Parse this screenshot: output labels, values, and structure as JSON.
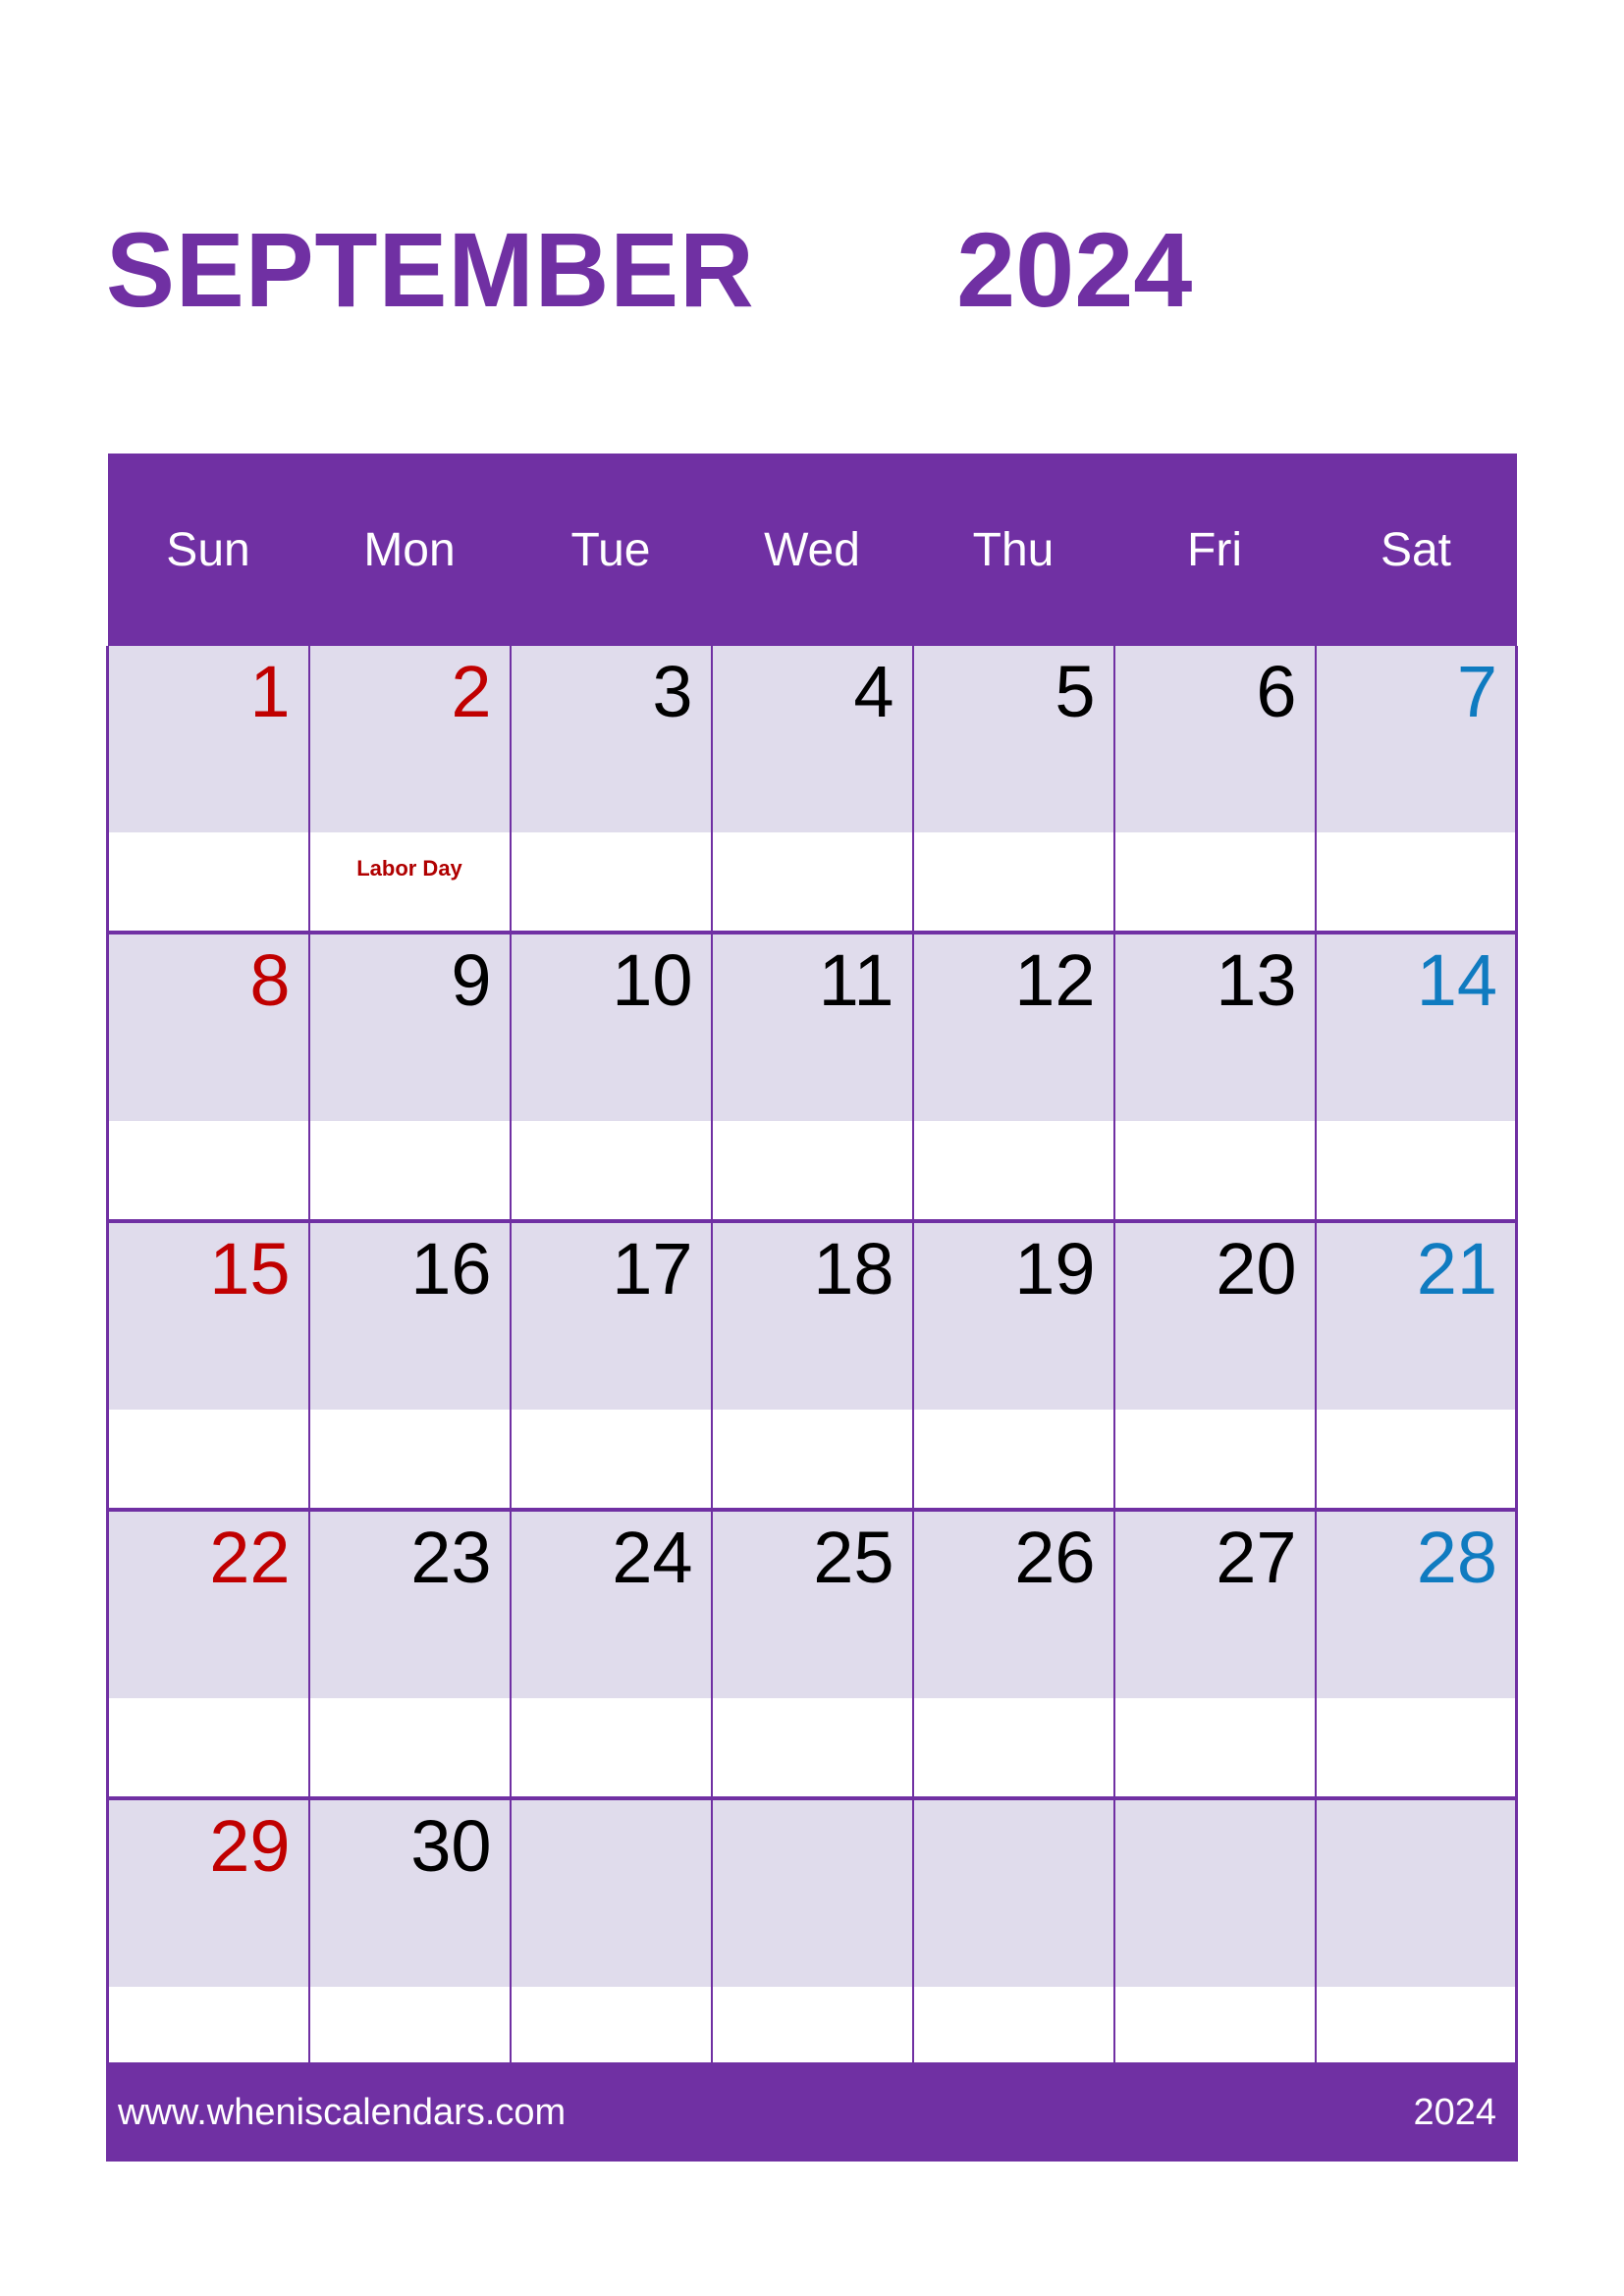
{
  "header": {
    "month": "SEPTEMBER",
    "year": "2024"
  },
  "colors": {
    "purple": "#7030A3",
    "lavender": "#E0DCEC",
    "sunday_red": "#C00000",
    "saturday_blue": "#0F7BC0",
    "event_red": "#B00000",
    "white": "#FFFFFF"
  },
  "weekdays": [
    {
      "label": "Sun"
    },
    {
      "label": "Mon"
    },
    {
      "label": "Tue"
    },
    {
      "label": "Wed"
    },
    {
      "label": "Thu"
    },
    {
      "label": "Fri"
    },
    {
      "label": "Sat"
    }
  ],
  "weeks": [
    {
      "days": [
        {
          "num": "1",
          "kind": "sun",
          "event": ""
        },
        {
          "num": "2",
          "kind": "holiday",
          "event": "Labor Day"
        },
        {
          "num": "3",
          "kind": "weekday",
          "event": ""
        },
        {
          "num": "4",
          "kind": "weekday",
          "event": ""
        },
        {
          "num": "5",
          "kind": "weekday",
          "event": ""
        },
        {
          "num": "6",
          "kind": "weekday",
          "event": ""
        },
        {
          "num": "7",
          "kind": "sat",
          "event": ""
        }
      ]
    },
    {
      "days": [
        {
          "num": "8",
          "kind": "sun",
          "event": ""
        },
        {
          "num": "9",
          "kind": "weekday",
          "event": ""
        },
        {
          "num": "10",
          "kind": "weekday",
          "event": ""
        },
        {
          "num": "11",
          "kind": "weekday",
          "event": ""
        },
        {
          "num": "12",
          "kind": "weekday",
          "event": ""
        },
        {
          "num": "13",
          "kind": "weekday",
          "event": ""
        },
        {
          "num": "14",
          "kind": "sat",
          "event": ""
        }
      ]
    },
    {
      "days": [
        {
          "num": "15",
          "kind": "sun",
          "event": ""
        },
        {
          "num": "16",
          "kind": "weekday",
          "event": ""
        },
        {
          "num": "17",
          "kind": "weekday",
          "event": ""
        },
        {
          "num": "18",
          "kind": "weekday",
          "event": ""
        },
        {
          "num": "19",
          "kind": "weekday",
          "event": ""
        },
        {
          "num": "20",
          "kind": "weekday",
          "event": ""
        },
        {
          "num": "21",
          "kind": "sat",
          "event": ""
        }
      ]
    },
    {
      "days": [
        {
          "num": "22",
          "kind": "sun",
          "event": ""
        },
        {
          "num": "23",
          "kind": "weekday",
          "event": ""
        },
        {
          "num": "24",
          "kind": "weekday",
          "event": ""
        },
        {
          "num": "25",
          "kind": "weekday",
          "event": ""
        },
        {
          "num": "26",
          "kind": "weekday",
          "event": ""
        },
        {
          "num": "27",
          "kind": "weekday",
          "event": ""
        },
        {
          "num": "28",
          "kind": "sat",
          "event": ""
        }
      ]
    },
    {
      "days": [
        {
          "num": "29",
          "kind": "sun",
          "event": ""
        },
        {
          "num": "30",
          "kind": "weekday",
          "event": ""
        },
        {
          "num": "",
          "kind": "empty",
          "event": ""
        },
        {
          "num": "",
          "kind": "empty",
          "event": ""
        },
        {
          "num": "",
          "kind": "empty",
          "event": ""
        },
        {
          "num": "",
          "kind": "empty",
          "event": ""
        },
        {
          "num": "",
          "kind": "empty",
          "event": ""
        }
      ]
    }
  ],
  "footer": {
    "url": "www.wheniscalendars.com",
    "year": "2024"
  }
}
